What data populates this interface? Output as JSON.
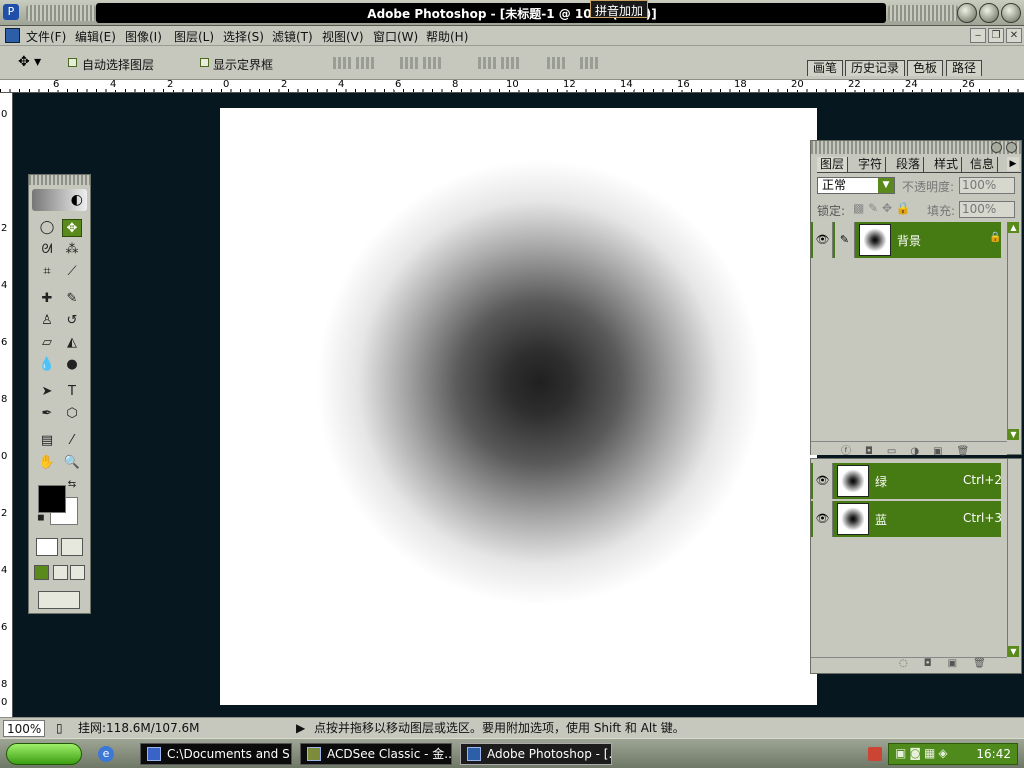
{
  "title": {
    "text": "Adobe Photoshop - [未标题-1 @ 100%(RGB)]",
    "ime": "拼音加加"
  },
  "menu": [
    "文件(F)",
    "编辑(E)",
    "图像(I)",
    "图层(L)",
    "选择(S)",
    "滤镜(T)",
    "视图(V)",
    "窗口(W)",
    "帮助(H)"
  ],
  "options": {
    "auto_select_layer": "自动选择图层",
    "show_bounding_box": "显示定界框"
  },
  "palette_well": [
    "画笔",
    "历史记录",
    "色板",
    "路径"
  ],
  "ruler": {
    "h_ticks": [
      "6",
      "4",
      "2",
      "0",
      "2",
      "4",
      "6",
      "8",
      "10",
      "12",
      "14",
      "16",
      "18",
      "20",
      "22",
      "24",
      "26"
    ],
    "v_ticks": [
      "0",
      "2",
      "4",
      "6",
      "8",
      "0",
      "2",
      "4",
      "6",
      "8",
      "0"
    ]
  },
  "layers_panel": {
    "tabs": [
      "图层",
      "字符",
      "段落",
      "样式",
      "信息"
    ],
    "blend_mode": "正常",
    "opacity_label": "不透明度:",
    "opacity_value": "100%",
    "lock_label": "锁定:",
    "fill_label": "填充:",
    "fill_value": "100%",
    "layers": [
      {
        "name": "背景"
      }
    ]
  },
  "channels_panel": {
    "channels": [
      {
        "name": "绿",
        "shortcut": "Ctrl+2"
      },
      {
        "name": "蓝",
        "shortcut": "Ctrl+3"
      }
    ]
  },
  "status": {
    "zoom": "100%",
    "doc_size": "挂网:118.6M/107.6M",
    "hint": "点按并拖移以移动图层或选区。要用附加选项，使用 Shift 和 Alt 键。"
  },
  "taskbar": {
    "tasks": [
      "C:\\Documents and S...",
      "ACDSee Classic - 金...",
      "Adobe Photoshop - [..."
    ],
    "clock": "16:42"
  },
  "colors": {
    "accent_green": "#467a12",
    "chrome": "#c6c8be",
    "canvas_bg": "#07171f"
  }
}
